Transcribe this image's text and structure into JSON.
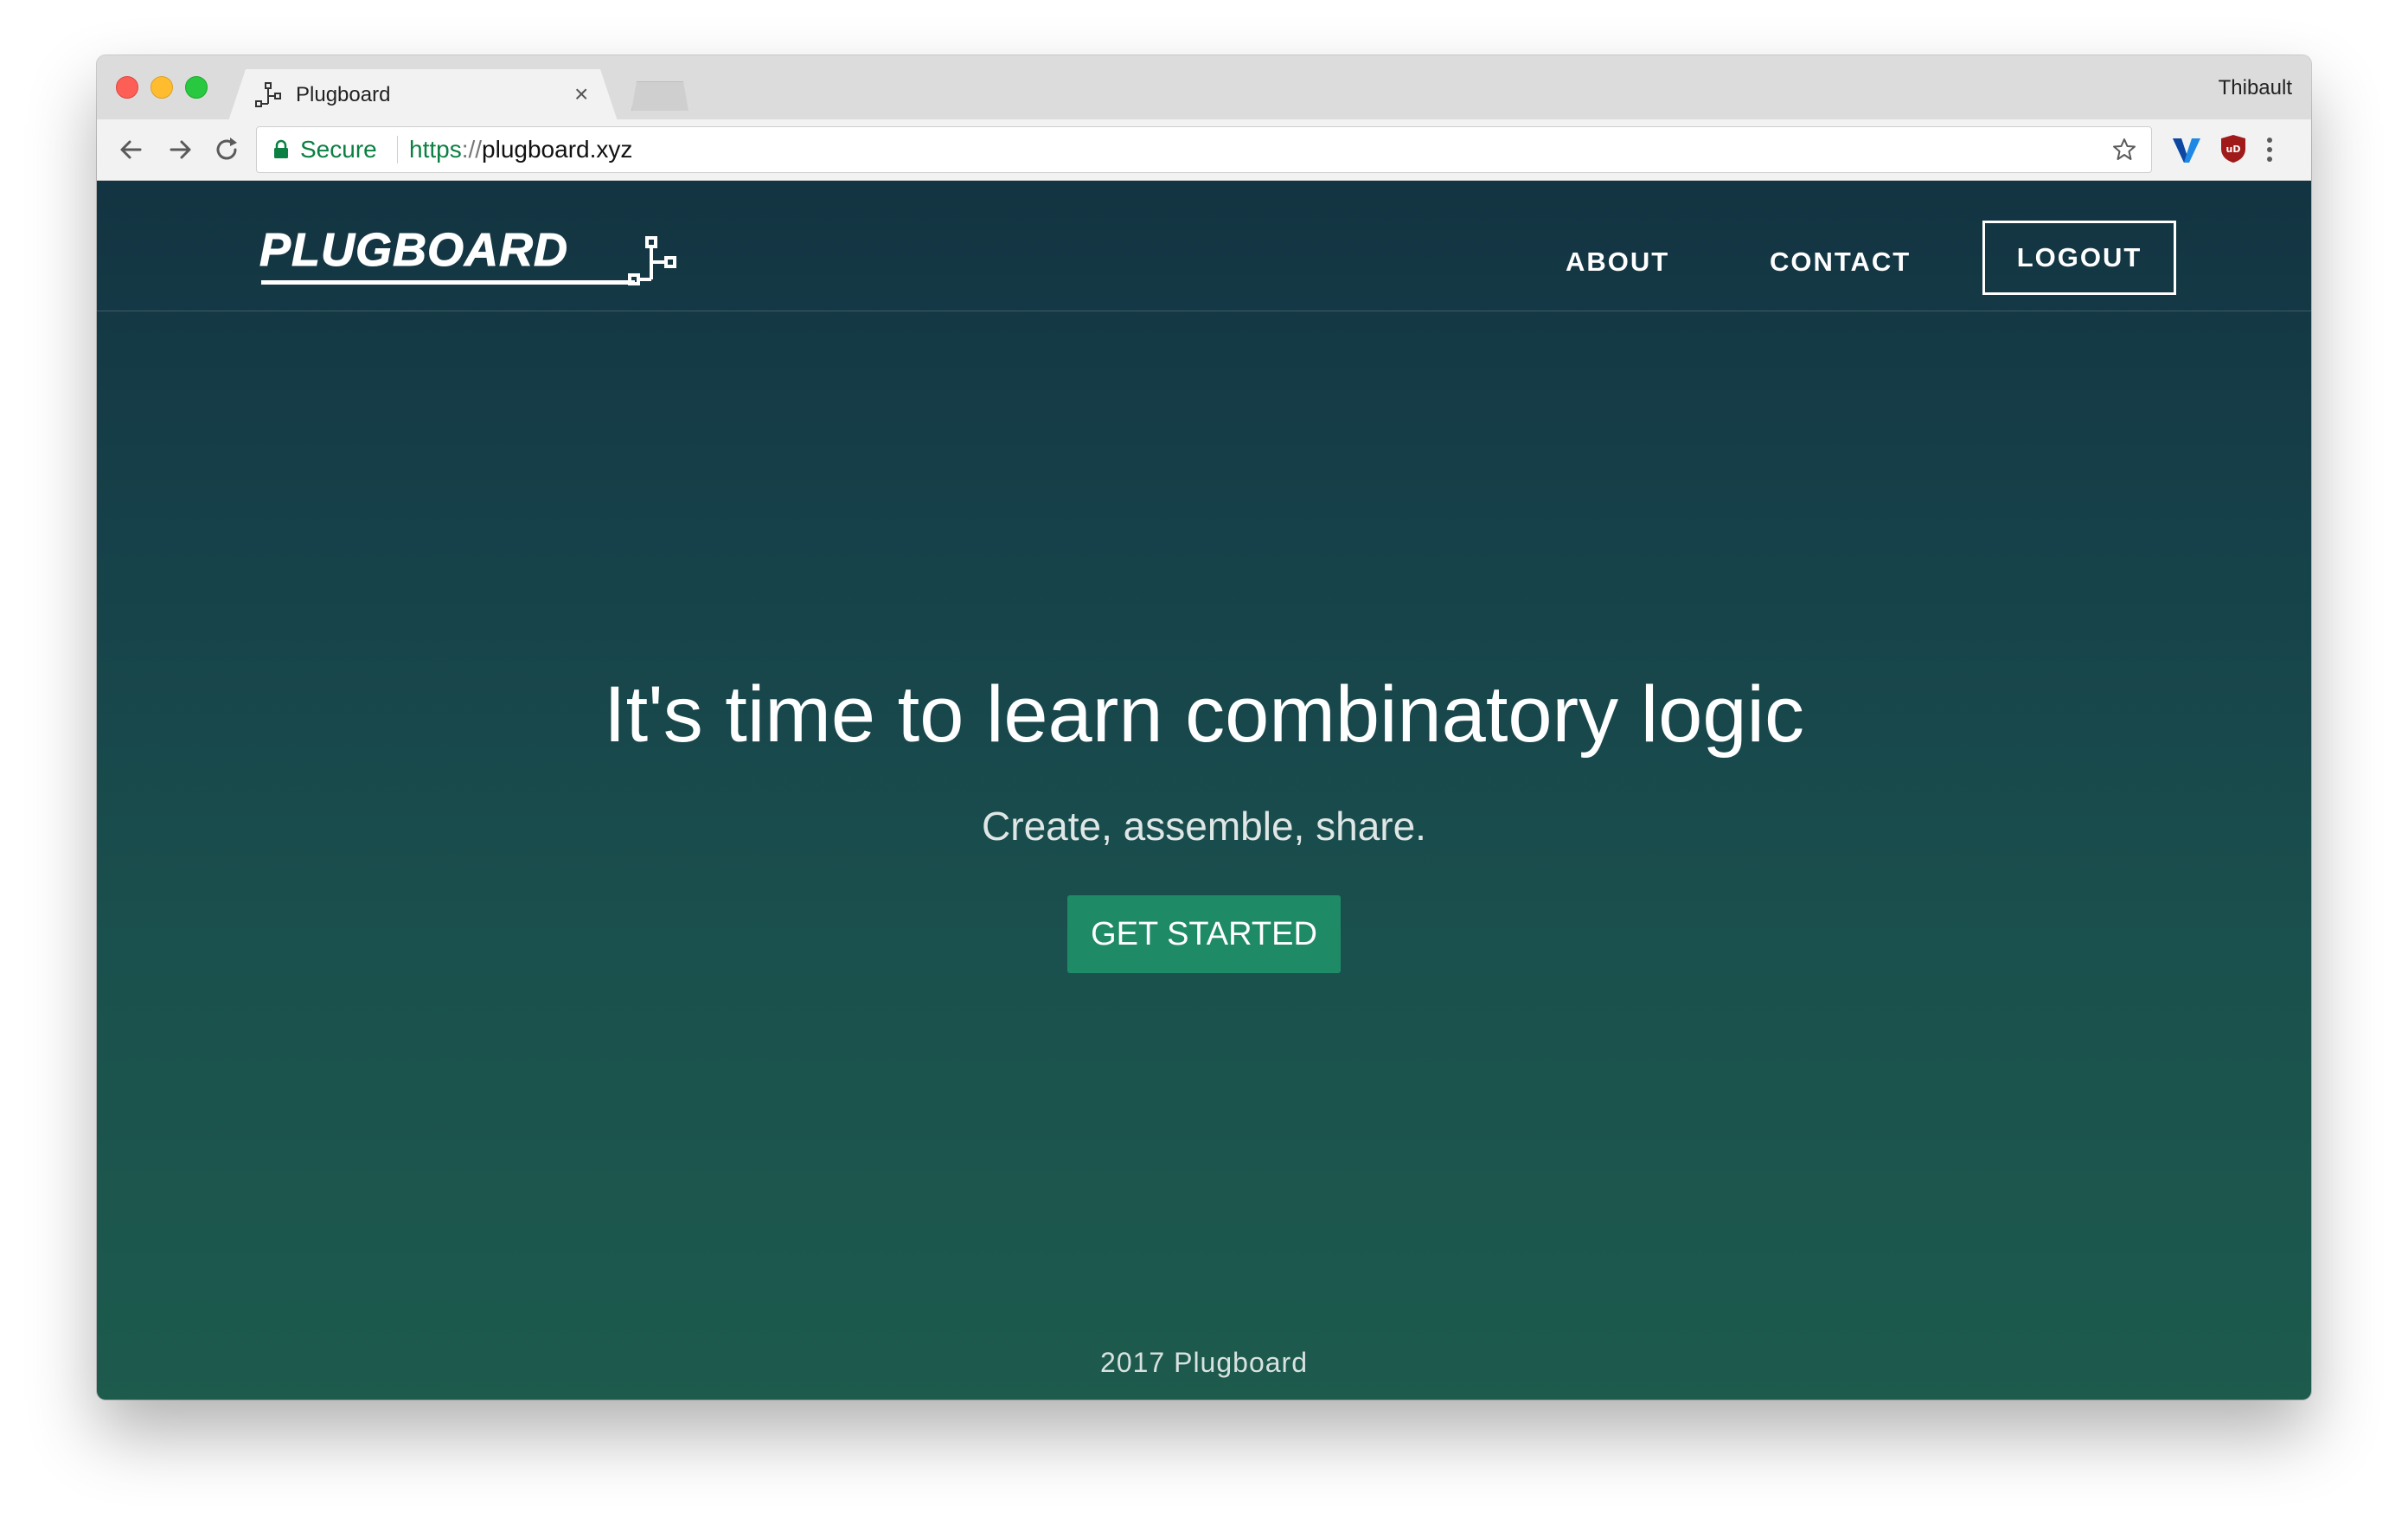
{
  "browser": {
    "tab_title": "Plugboard",
    "tab_close": "×",
    "profile_name": "Thibault",
    "secure_label": "Secure",
    "url_scheme": "https",
    "url_slashes": "://",
    "url_host": "plugboard.xyz"
  },
  "site": {
    "logo_text": "PLUGBOARD",
    "nav": {
      "about": "ABOUT",
      "contact": "CONTACT",
      "logout": "LOGOUT"
    },
    "hero": {
      "title": "It's time to learn combinatory logic",
      "subtitle": "Create, assemble, share.",
      "cta": "GET STARTED"
    },
    "footer": "2017 Plugboard"
  },
  "colors": {
    "page_gradient_top": "#133442",
    "page_gradient_bottom": "#1d5b4d",
    "cta_background": "#1f8a66",
    "secure_green": "#0b8043"
  },
  "icons": {
    "tab_favicon": "plugboard-logo-icon",
    "back": "arrow-left-icon",
    "forward": "arrow-right-icon",
    "reload": "reload-icon",
    "lock": "lock-icon",
    "bookmark": "star-icon",
    "extension_1": "v-extension-icon",
    "extension_2": "ublock-shield-icon",
    "menu": "kebab-menu-icon"
  }
}
